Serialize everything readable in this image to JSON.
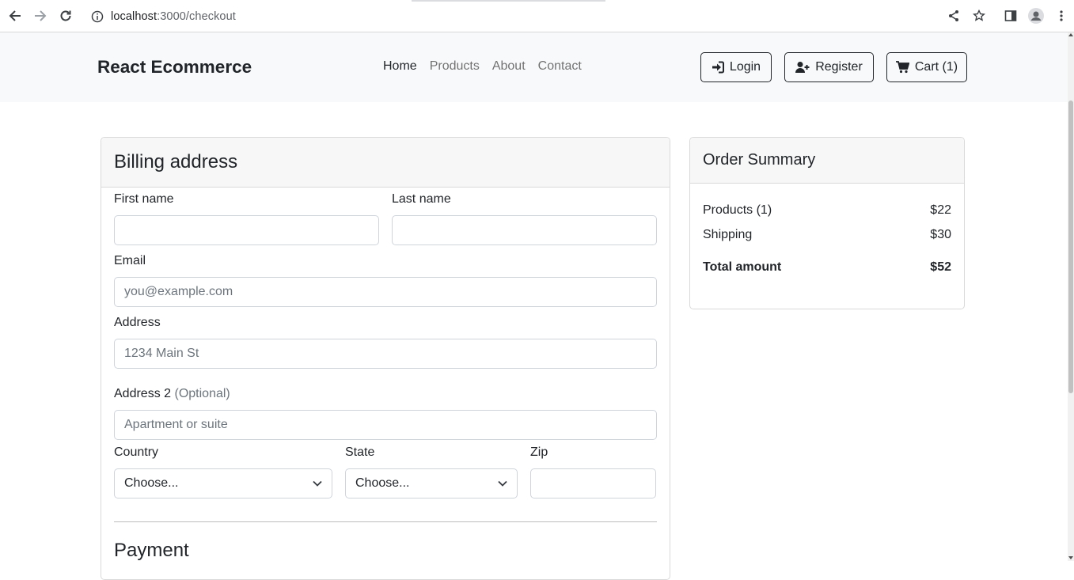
{
  "browser": {
    "url_host": "localhost",
    "url_path": ":3000/checkout"
  },
  "navbar": {
    "brand": "React Ecommerce",
    "links": [
      {
        "label": "Home",
        "active": true
      },
      {
        "label": "Products",
        "active": false
      },
      {
        "label": "About",
        "active": false
      },
      {
        "label": "Contact",
        "active": false
      }
    ],
    "login_label": "Login",
    "register_label": "Register",
    "cart_label": "Cart (1)"
  },
  "billing": {
    "title": "Billing address",
    "first_name_label": "First name",
    "last_name_label": "Last name",
    "email_label": "Email",
    "email_placeholder": "you@example.com",
    "address_label": "Address",
    "address_placeholder": "1234 Main St",
    "address2_label": "Address 2",
    "address2_optional": "(Optional)",
    "address2_placeholder": "Apartment or suite",
    "country_label": "Country",
    "country_value": "Choose...",
    "state_label": "State",
    "state_value": "Choose...",
    "zip_label": "Zip",
    "payment_title": "Payment"
  },
  "summary": {
    "title": "Order Summary",
    "products_label": "Products (1)",
    "products_value": "$22",
    "shipping_label": "Shipping",
    "shipping_value": "$30",
    "total_label": "Total amount",
    "total_value": "$52"
  },
  "colors": {
    "navbar_bg": "#f8f9fa",
    "card_header_bg": "#f7f7f7",
    "border": "#d9d9d9",
    "text": "#212529",
    "muted": "#6c757d"
  }
}
